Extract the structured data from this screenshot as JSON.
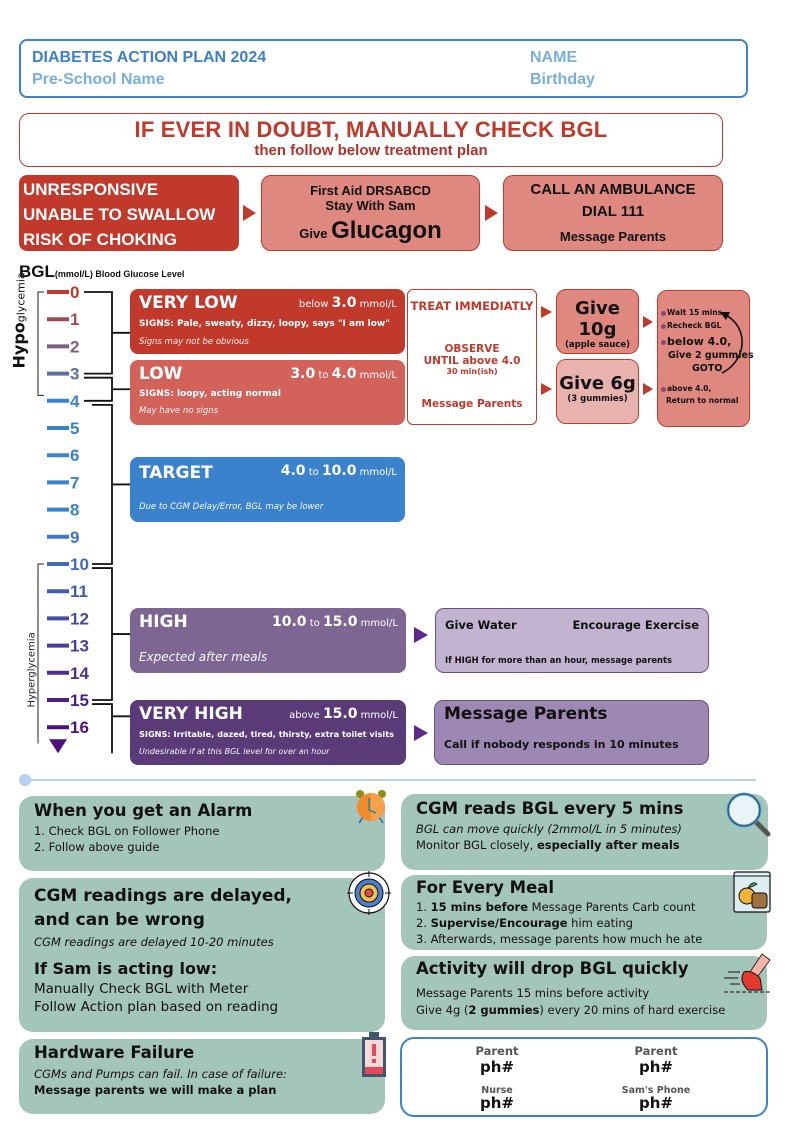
{
  "header": {
    "title": "DIABETES ACTION PLAN 2024",
    "school": "Pre-School Name",
    "name": "NAME",
    "birthday": "Birthday"
  },
  "doubt_banner": {
    "headline": "IF EVER IN DOUBT, MANUALLY CHECK BGL",
    "subline": "then follow below treatment plan"
  },
  "emergency": {
    "conditions": [
      "UNRESPONSIVE",
      "UNABLE TO SWALLOW",
      "RISK OF CHOKING"
    ],
    "first_aid": {
      "line1": "First Aid DRSABCD",
      "line2": "Stay With Sam",
      "give_prefix": "Give",
      "give_item": "Glucagon"
    },
    "ambulance": {
      "line1": "CALL AN AMBULANCE",
      "line2": "DIAL 111",
      "line3": "Message Parents"
    }
  },
  "bgl_title": {
    "main": "BGL",
    "unit": "(mmol/L) Blood Glucose Level"
  },
  "scale": {
    "ticks": [
      "0",
      "1",
      "2",
      "3",
      "4",
      "5",
      "6",
      "7",
      "8",
      "9",
      "10",
      "11",
      "12",
      "13",
      "14",
      "15",
      "16"
    ],
    "hypo_label_bold": "Hypo",
    "hypo_label_rest": "glycemia",
    "hyper_label": "Hyperglycemia",
    "colors": {
      "low": "#c0392b",
      "mid": "#3b82cd",
      "high": "#4e117f"
    }
  },
  "levels": {
    "very_low": {
      "name": "VERY LOW",
      "range_prefix": "below",
      "range_from": "3.0",
      "unit": "mmol/L",
      "signs": "SIGNS: Pale, sweaty, dizzy, loopy, says \"I am low\"",
      "note": "Signs may not be obvious",
      "color": "#c0392b"
    },
    "low": {
      "name": "LOW",
      "range_from": "3.0",
      "range_to_word": "to",
      "range_to": "4.0",
      "unit": "mmol/L",
      "signs": "SIGNS: loopy, acting normal",
      "note": "May have no signs",
      "color": "#d2625a"
    },
    "target": {
      "name": "TARGET",
      "range_from": "4.0",
      "range_to_word": "to",
      "range_to": "10.0",
      "unit": "mmol/L",
      "note": "Due to CGM Delay/Error, BGL may be lower",
      "color": "#3b82cd"
    },
    "high": {
      "name": "HIGH",
      "range_from": "10.0",
      "range_to_word": "to",
      "range_to": "15.0",
      "unit": "mmol/L",
      "note": "Expected after meals",
      "color": "#7e6693"
    },
    "very_high": {
      "name": "VERY HIGH",
      "range_prefix": "above",
      "range_from": "15.0",
      "unit": "mmol/L",
      "signs": "SIGNS: Irritable, dazed, tired, thirsty, extra toilet visits",
      "note": "Undesirable if at this BGL level for  over an hour",
      "color": "#5b3a78"
    }
  },
  "hypo_treatment": {
    "treat": "TREAT IMMEDIATLY",
    "observe": "OBSERVE",
    "until": "UNTIL above 4.0",
    "duration": "30 min(ish)",
    "message": "Message Parents",
    "give_very_low": {
      "amount": "Give 10g",
      "detail": "(apple sauce)"
    },
    "give_low": {
      "amount": "Give 6g",
      "detail": "(3 gummies)"
    },
    "recheck": {
      "step1": "Wait 15 mins",
      "step2": "Recheck BGL",
      "step3a": "below 4.0,",
      "step3b": "Give 2 gummies",
      "step3c": "GOTO",
      "step4a": "above 4.0,",
      "step4b": "Return to normal"
    }
  },
  "high_actions": {
    "water": "Give Water",
    "exercise": "Encourage Exercise",
    "note": "If HIGH for more than an hour, message parents"
  },
  "very_high_actions": {
    "title": "Message Parents",
    "note": "Call if nobody responds in 10 minutes"
  },
  "info": {
    "alarm": {
      "title": "When you get an Alarm",
      "lines": [
        "1. Check BGL on Follower Phone",
        "2. Follow above guide"
      ],
      "icon": "alarm-clock-icon"
    },
    "cgm_interval": {
      "title": "CGM reads BGL every 5 mins",
      "line1": "BGL can move quickly (2mmol/L in 5 minutes)",
      "line2_prefix": "Monitor BGL closely, ",
      "line2_bold": "especially after meals",
      "icon": "magnifier-icon"
    },
    "delayed": {
      "title1": "CGM readings are delayed,",
      "title2": "and can be wrong",
      "note": "CGM readings are delayed 10-20 minutes",
      "sub_title": "If Sam is acting low:",
      "lines": [
        "Manually Check BGL with Meter",
        "Follow Action plan based on reading"
      ],
      "icon": "target-icon"
    },
    "meal": {
      "title": "For Every Meal",
      "line1_bold": "15 mins before",
      "line1_rest": " Message Parents Carb count",
      "line2_bold": "Supervise/Encourage",
      "line2_rest": " him eating",
      "line3": "3. Afterwards, message parents how much he ate",
      "prefix1": "1. ",
      "prefix2": "2. ",
      "icon": "lunch-bag-icon"
    },
    "activity": {
      "title": "Activity will drop BGL quickly",
      "line1": "Message Parents 15 mins before activity",
      "line2_prefix": "Give 4g (",
      "line2_bold": "2 gummies",
      "line2_rest": ") every 20 mins of hard exercise",
      "icon": "running-shoe-icon"
    },
    "hardware": {
      "title": "Hardware Failure",
      "line1": "CGMs and Pumps can fail. In case of failure:",
      "line2": "Message parents we will make a plan",
      "icon": "battery-alert-icon"
    }
  },
  "contacts": [
    {
      "label": "Parent",
      "value": "ph#"
    },
    {
      "label": "Parent",
      "value": "ph#"
    },
    {
      "label": "Nurse",
      "value": "ph#"
    },
    {
      "label": "Sam's Phone",
      "value": "ph#"
    }
  ]
}
